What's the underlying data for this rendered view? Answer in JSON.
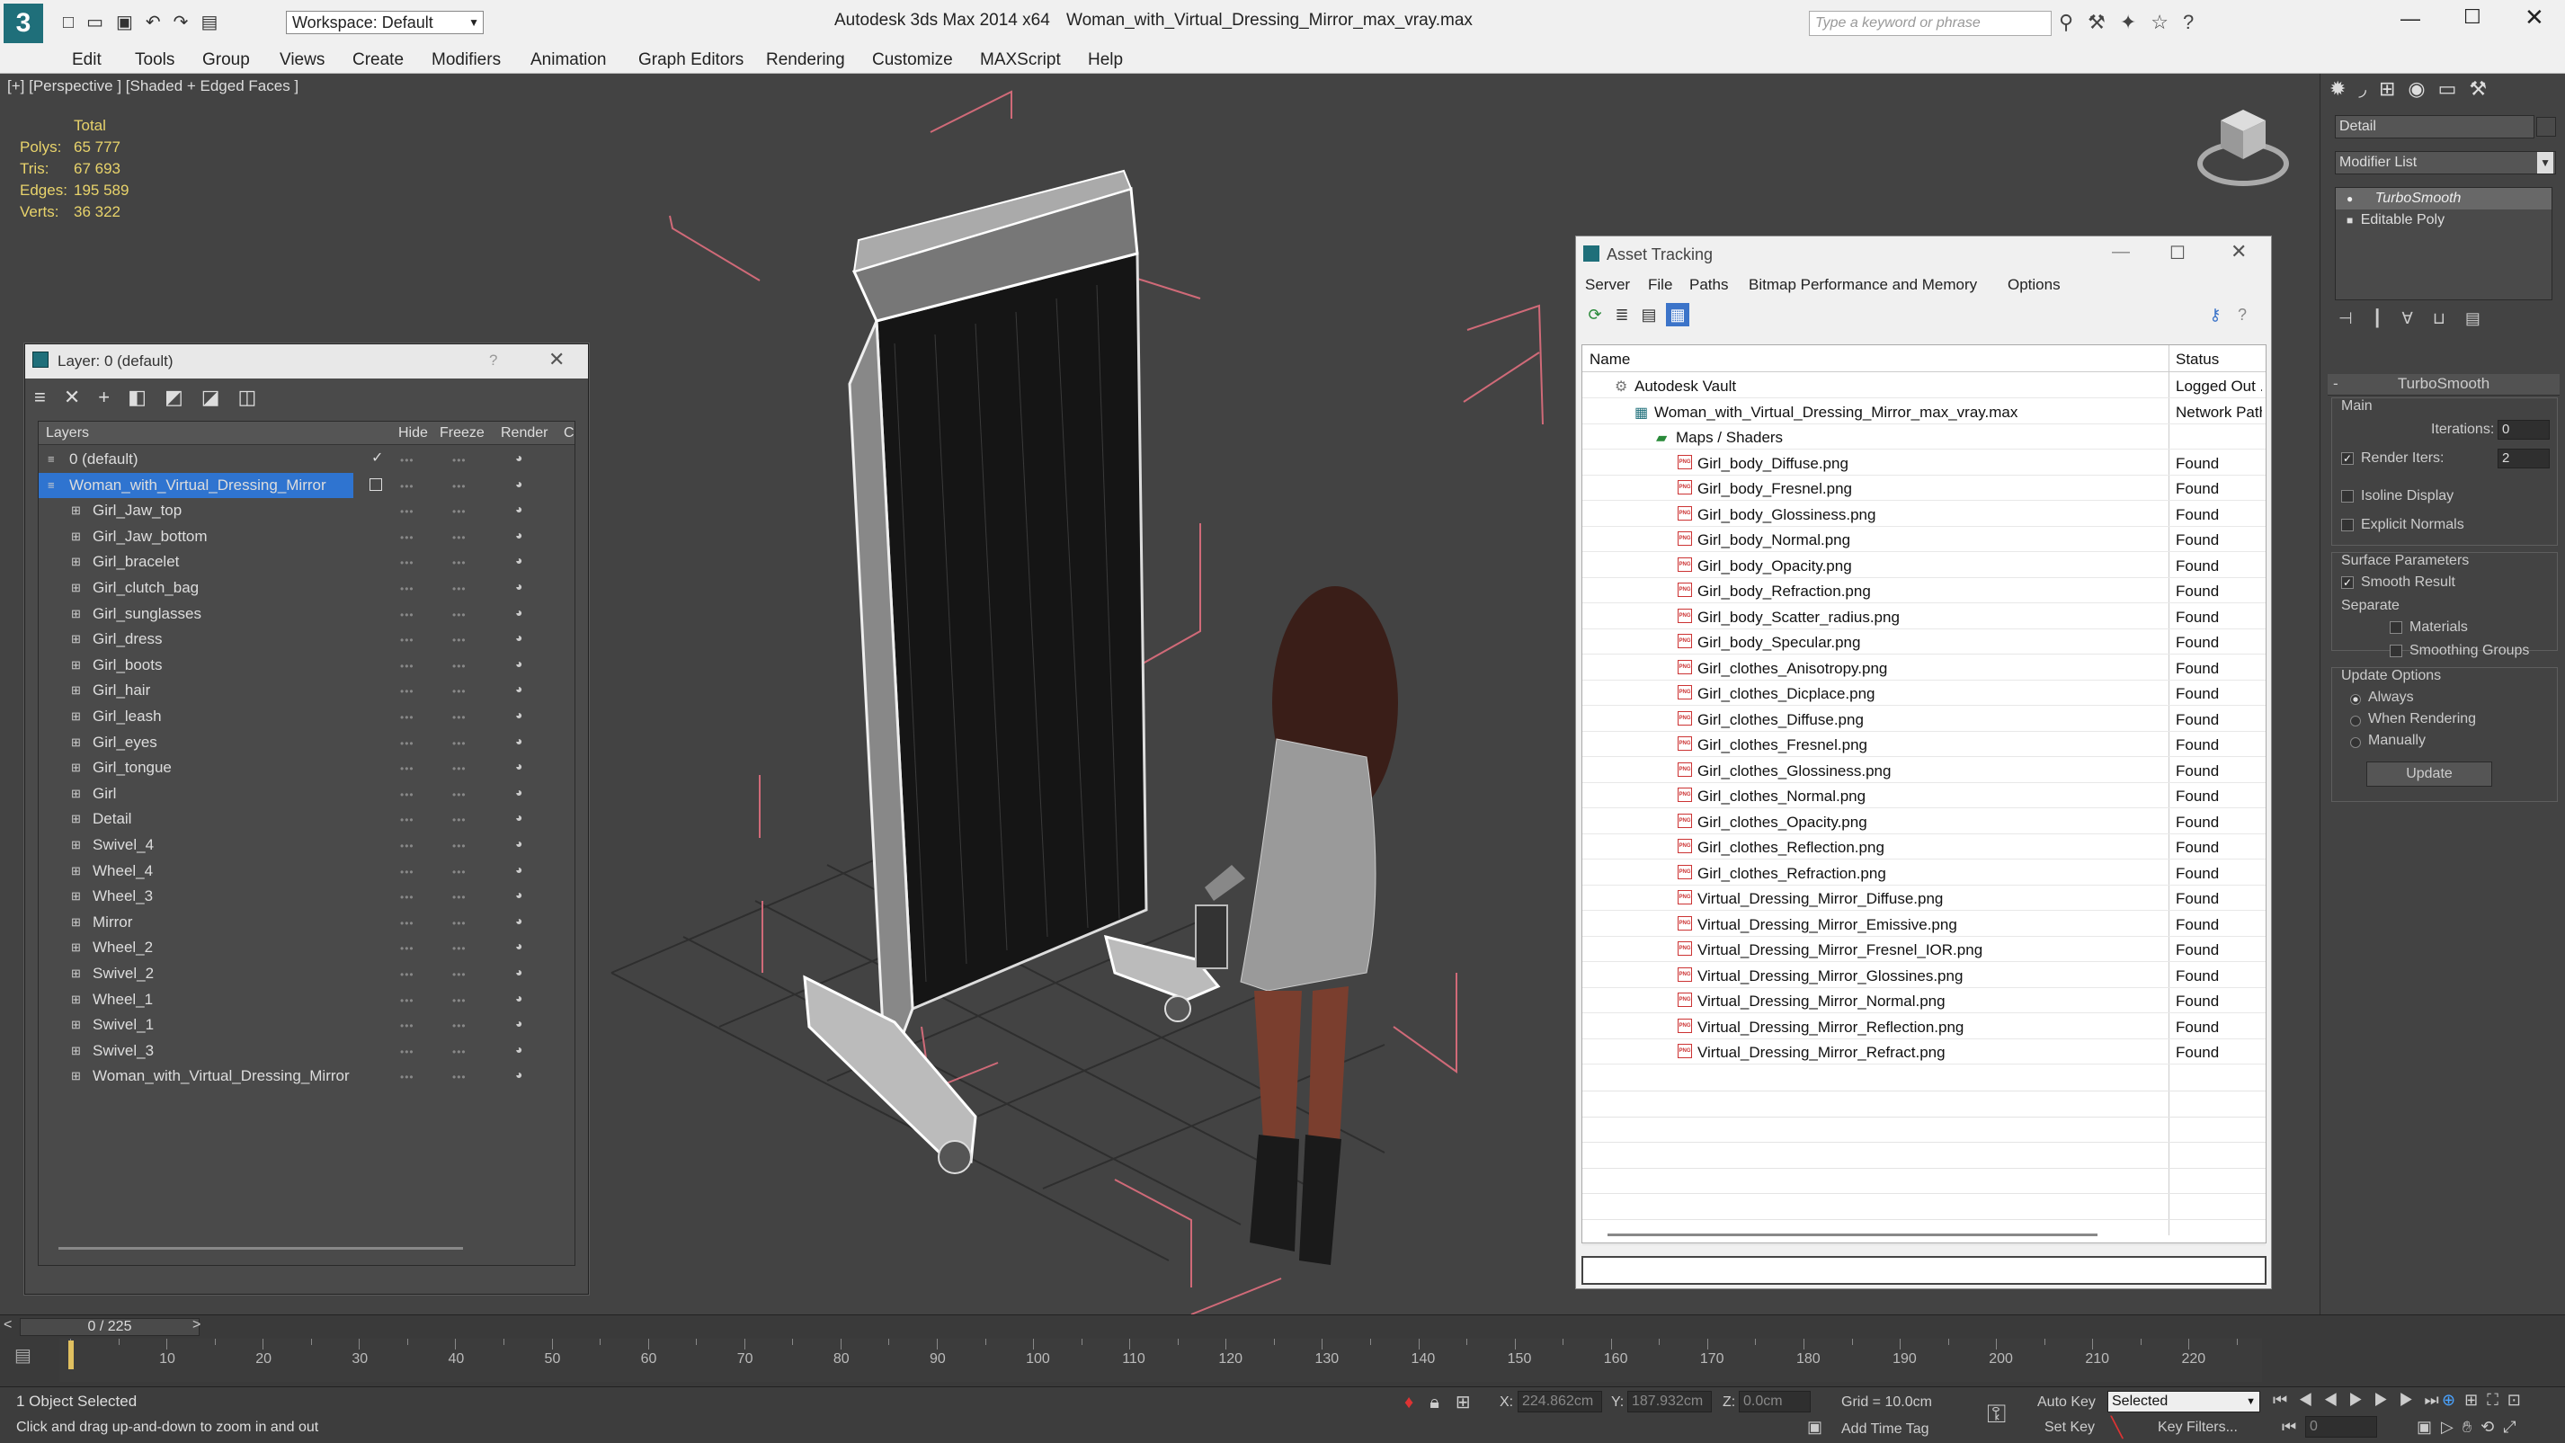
{
  "titlebar": {
    "app_title": "Autodesk 3ds Max  2014 x64",
    "file_title": "Woman_with_Virtual_Dressing_Mirror_max_vray.max",
    "workspace": "Workspace: Default",
    "search_placeholder": "Type a keyword or phrase"
  },
  "menu": [
    "Edit",
    "Tools",
    "Group",
    "Views",
    "Create",
    "Modifiers",
    "Animation",
    "Graph Editors",
    "Rendering",
    "Customize",
    "MAXScript",
    "Help"
  ],
  "viewport": {
    "label": "[+] [Perspective ] [Shaded + Edged Faces ]",
    "stats": {
      "header": "Total",
      "polys_label": "Polys:",
      "polys": "65 777",
      "tris_label": "Tris:",
      "tris": "67 693",
      "edges_label": "Edges:",
      "edges": "195 589",
      "verts_label": "Verts:",
      "verts": "36 322"
    }
  },
  "layer_window": {
    "title": "Layer: 0 (default)",
    "help": "?",
    "columns": {
      "layers": "Layers",
      "hide": "Hide",
      "freeze": "Freeze",
      "render": "Render",
      "c": "C"
    },
    "rows": [
      {
        "label": "0 (default)"
      },
      {
        "label": "Woman_with_Virtual_Dressing_Mirror"
      },
      {
        "label": "Girl_Jaw_top"
      },
      {
        "label": "Girl_Jaw_bottom"
      },
      {
        "label": "Girl_bracelet"
      },
      {
        "label": "Girl_clutch_bag"
      },
      {
        "label": "Girl_sunglasses"
      },
      {
        "label": "Girl_dress"
      },
      {
        "label": "Girl_boots"
      },
      {
        "label": "Girl_hair"
      },
      {
        "label": "Girl_leash"
      },
      {
        "label": "Girl_eyes"
      },
      {
        "label": "Girl_tongue"
      },
      {
        "label": "Girl"
      },
      {
        "label": "Detail"
      },
      {
        "label": "Swivel_4"
      },
      {
        "label": "Wheel_4"
      },
      {
        "label": "Wheel_3"
      },
      {
        "label": "Mirror"
      },
      {
        "label": "Wheel_2"
      },
      {
        "label": "Swivel_2"
      },
      {
        "label": "Wheel_1"
      },
      {
        "label": "Swivel_1"
      },
      {
        "label": "Swivel_3"
      },
      {
        "label": "Woman_with_Virtual_Dressing_Mirror"
      }
    ]
  },
  "asset_window": {
    "title": "Asset Tracking",
    "menu": [
      "Server",
      "File",
      "Paths",
      "Bitmap Performance and Memory",
      "Options"
    ],
    "col_name": "Name",
    "col_status": "Status",
    "rows": [
      {
        "name": "Autodesk Vault",
        "status": "Logged Out ."
      },
      {
        "name": "Woman_with_Virtual_Dressing_Mirror_max_vray.max",
        "status": "Network Path"
      },
      {
        "name": "Maps / Shaders",
        "status": ""
      },
      {
        "name": "Girl_body_Diffuse.png",
        "status": "Found"
      },
      {
        "name": "Girl_body_Fresnel.png",
        "status": "Found"
      },
      {
        "name": "Girl_body_Glossiness.png",
        "status": "Found"
      },
      {
        "name": "Girl_body_Normal.png",
        "status": "Found"
      },
      {
        "name": "Girl_body_Opacity.png",
        "status": "Found"
      },
      {
        "name": "Girl_body_Refraction.png",
        "status": "Found"
      },
      {
        "name": "Girl_body_Scatter_radius.png",
        "status": "Found"
      },
      {
        "name": "Girl_body_Specular.png",
        "status": "Found"
      },
      {
        "name": "Girl_clothes_Anisotropy.png",
        "status": "Found"
      },
      {
        "name": "Girl_clothes_Dicplace.png",
        "status": "Found"
      },
      {
        "name": "Girl_clothes_Diffuse.png",
        "status": "Found"
      },
      {
        "name": "Girl_clothes_Fresnel.png",
        "status": "Found"
      },
      {
        "name": "Girl_clothes_Glossiness.png",
        "status": "Found"
      },
      {
        "name": "Girl_clothes_Normal.png",
        "status": "Found"
      },
      {
        "name": "Girl_clothes_Opacity.png",
        "status": "Found"
      },
      {
        "name": "Girl_clothes_Reflection.png",
        "status": "Found"
      },
      {
        "name": "Girl_clothes_Refraction.png",
        "status": "Found"
      },
      {
        "name": "Virtual_Dressing_Mirror_Diffuse.png",
        "status": "Found"
      },
      {
        "name": "Virtual_Dressing_Mirror_Emissive.png",
        "status": "Found"
      },
      {
        "name": "Virtual_Dressing_Mirror_Fresnel_IOR.png",
        "status": "Found"
      },
      {
        "name": "Virtual_Dressing_Mirror_Glossines.png",
        "status": "Found"
      },
      {
        "name": "Virtual_Dressing_Mirror_Normal.png",
        "status": "Found"
      },
      {
        "name": "Virtual_Dressing_Mirror_Reflection.png",
        "status": "Found"
      },
      {
        "name": "Virtual_Dressing_Mirror_Refract.png",
        "status": "Found"
      }
    ]
  },
  "command_panel": {
    "object_name": "Detail",
    "modifier_list": "Modifier List",
    "stack": [
      "TurboSmooth",
      "Editable Poly"
    ],
    "rollout_title": "TurboSmooth",
    "main_label": "Main",
    "iterations_label": "Iterations:",
    "iterations": "0",
    "render_iters_label": "Render Iters:",
    "render_iters": "2",
    "isoline": "Isoline Display",
    "explicit_normals": "Explicit Normals",
    "surface_params": "Surface Parameters",
    "smooth_result": "Smooth Result",
    "separate": "Separate",
    "materials": "Materials",
    "smoothing_groups": "Smoothing Groups",
    "update_options": "Update Options",
    "always": "Always",
    "when_rendering": "When Rendering",
    "manually": "Manually",
    "update_btn": "Update"
  },
  "timeline": {
    "frame": "0 / 225",
    "ticks": [
      "10",
      "20",
      "30",
      "40",
      "50",
      "60",
      "70",
      "80",
      "90",
      "100",
      "110",
      "120",
      "130",
      "140",
      "150",
      "160",
      "170",
      "180",
      "190",
      "200",
      "210",
      "220"
    ]
  },
  "status": {
    "selected": "1 Object Selected",
    "prompt": "Click and drag up-and-down to zoom in and out",
    "x_label": "X:",
    "x": "224.862cm",
    "y_label": "Y:",
    "y": "187.932cm",
    "z_label": "Z:",
    "z": "0.0cm",
    "grid": "Grid = 10.0cm",
    "auto_key": "Auto Key",
    "selected_dd": "Selected",
    "set_key": "Set Key",
    "key_filters": "Key Filters...",
    "add_time_tag": "Add Time Tag",
    "frame_field": "0"
  }
}
